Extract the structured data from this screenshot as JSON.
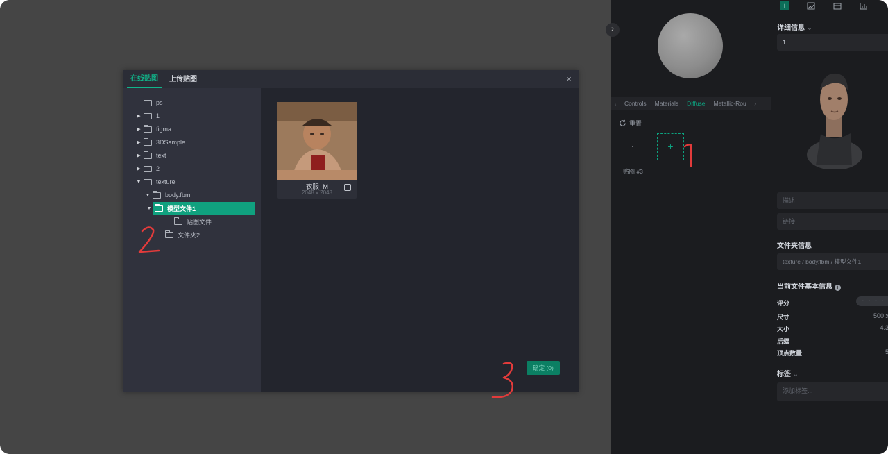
{
  "modal": {
    "tabs": [
      "在线贴图",
      "上传贴图"
    ],
    "close_icon": "close-icon",
    "tree": [
      {
        "label": "ps"
      },
      {
        "label": "1"
      },
      {
        "label": "figma"
      },
      {
        "label": "3DSample"
      },
      {
        "label": "text"
      },
      {
        "label": "2"
      },
      {
        "label": "texture"
      },
      {
        "label": "body.fbm"
      },
      {
        "label": "模型文件1"
      },
      {
        "label": "贴图文件"
      },
      {
        "label": "文件夹2"
      }
    ],
    "thumbnail": {
      "name": "衣服_M",
      "size": "2048 x 2048"
    },
    "confirm_label": "确定 (0)"
  },
  "mid_panel": {
    "collapse_icon": "chevron-right-icon",
    "tabs": [
      "Controls",
      "Materials",
      "Diffuse",
      "Metallic-Rou"
    ],
    "reset_label": "重置",
    "add_icon": "plus-icon",
    "map_label": "贴图 #3",
    "dot": "·"
  },
  "right_panel": {
    "icons": [
      "info-icon",
      "image-icon",
      "layers-icon",
      "chart-icon"
    ],
    "details_title": "详细信息",
    "name_value": "1",
    "description_placeholder": "描述",
    "link_placeholder": "链接",
    "folder_info_title": "文件夹信息",
    "folder_path": "texture / body.fbm / 模型文件1",
    "file_info_title": "当前文件基本信息",
    "rows": [
      {
        "label": "评分",
        "value": ""
      },
      {
        "label": "尺寸",
        "value": "500 x"
      },
      {
        "label": "大小",
        "value": "4.3"
      },
      {
        "label": "后缀",
        "value": ""
      },
      {
        "label": "顶点数量",
        "value": "5"
      }
    ],
    "rating": "- - - -",
    "tags_title": "标签",
    "tags_placeholder": "添加标签..."
  },
  "annotations": [
    "1",
    "2",
    "3"
  ],
  "colors": {
    "accent": "#0ca27f",
    "annotation": "#e23b3b"
  }
}
